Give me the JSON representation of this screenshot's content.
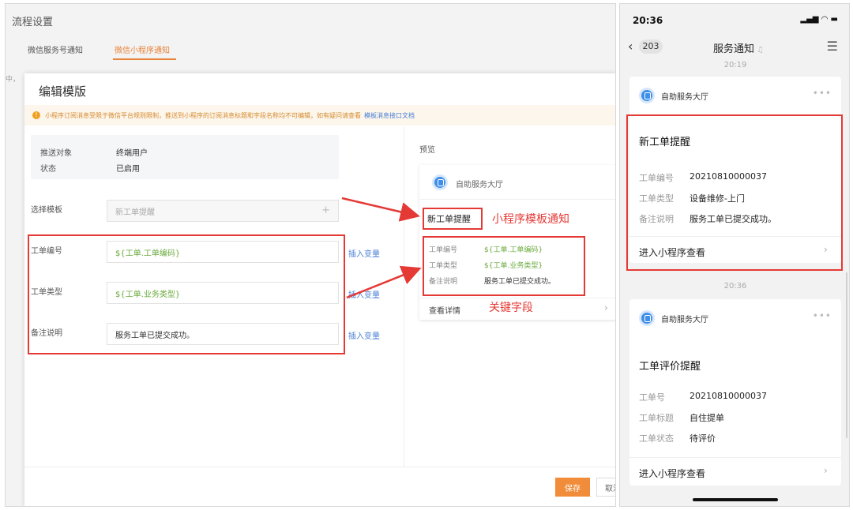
{
  "admin": {
    "page_title": "流程设置",
    "tabs": [
      {
        "label": "微信服务号通知",
        "active": false
      },
      {
        "label": "微信小程序通知",
        "active": true
      }
    ],
    "clipped_text": "中，",
    "modal": {
      "title": "编辑模版",
      "notice": "小程序订阅消息受限于微信平台规则限制，推送到小程序的订阅消息标题和字段名称均不可编辑，如有疑问请查看",
      "notice_link": "模板消息接口文档",
      "info": {
        "target_label": "推送对象",
        "target_value": "终端用户",
        "status_label": "状态",
        "status_value": "已启用"
      },
      "template_label": "选择模板",
      "template_value": "新工单提醒",
      "fields": [
        {
          "label": "工单编号",
          "value": "${工单.工单编码}",
          "kind": "var"
        },
        {
          "label": "工单类型",
          "value": "${工单.业务类型}",
          "kind": "var"
        },
        {
          "label": "备注说明",
          "value": "服务工单已提交成功。",
          "kind": "text"
        }
      ],
      "insert_var_label": "插入变量",
      "preview": {
        "label": "预览",
        "app_name": "自助服务大厅",
        "title": "新工单提醒",
        "rows": [
          {
            "label": "工单编号",
            "value": "${工单.工单编码}",
            "kind": "var"
          },
          {
            "label": "工单类型",
            "value": "${工单.业务类型}",
            "kind": "var"
          },
          {
            "label": "备注说明",
            "value": "服务工单已提交成功。",
            "kind": "text"
          }
        ],
        "detail_label": "查看详情"
      },
      "save_label": "保存",
      "cancel_label": "取消"
    },
    "annotations": {
      "template_notice": "小程序模板通知",
      "key_fields": "关键字段"
    }
  },
  "phone": {
    "status_time": "20:36",
    "status_icons": "▂▄▆ ◠ ▬",
    "back_count": "203",
    "nav_title": "服务通知",
    "time_1": "20:19",
    "time_2": "20:36",
    "cards": [
      {
        "app_name": "自助服务大厅",
        "title": "新工单提醒",
        "rows": [
          {
            "label": "工单编号",
            "value": "20210810000037"
          },
          {
            "label": "工单类型",
            "value": "设备维修-上门"
          },
          {
            "label": "备注说明",
            "value": "服务工单已提交成功。"
          }
        ],
        "link": "进入小程序查看"
      },
      {
        "app_name": "自助服务大厅",
        "title": "工单评价提醒",
        "rows": [
          {
            "label": "工单号",
            "value": "20210810000037"
          },
          {
            "label": "工单标题",
            "value": "自住提单"
          },
          {
            "label": "工单状态",
            "value": "待评价"
          }
        ],
        "link": "进入小程序查看"
      }
    ]
  },
  "colors": {
    "accent_orange": "#f08c3a",
    "annotation_red": "#e53935",
    "variable_green": "#6aaa3c",
    "link_blue": "#4a7fd6"
  }
}
